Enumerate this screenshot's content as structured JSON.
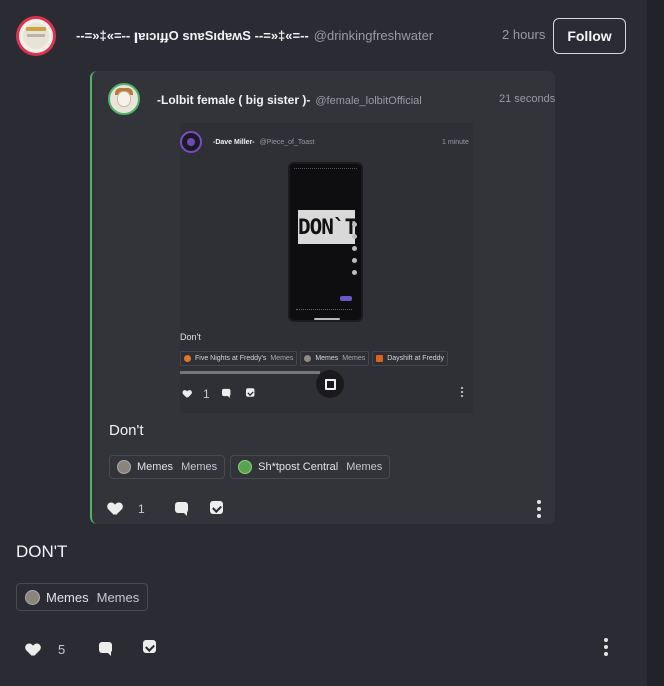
{
  "post": {
    "author_name": "--=»‡«=-- ꞁɐıɔıɟɟO snɐSıdɐʍS --=»‡«=--",
    "author_handle": "@drinkingfreshwater",
    "time": "2 hours",
    "follow_label": "Follow",
    "caption": "DON'T",
    "tags": [
      {
        "icon": "memes-community-icon",
        "community": "Memes",
        "channel": "Memes"
      }
    ],
    "likes": "5"
  },
  "quote": {
    "author_name": "-Lolbit female ( big sister )-",
    "author_handle": "@female_lolbitOfficial",
    "time": "21 seconds",
    "caption": "Don't",
    "tags": [
      {
        "icon": "memes-community-icon",
        "community": "Memes",
        "channel": "Memes"
      },
      {
        "icon": "shitpost-community-icon",
        "community": "Sh*tpost Central",
        "channel": "Memes"
      }
    ],
    "likes": "1"
  },
  "inner": {
    "author_name": "-Dave Miller-",
    "author_handle": "@Piece_of_Toast",
    "time": "1 minute",
    "video_text": "DON`T",
    "caption": "Don't",
    "tags": [
      {
        "icon": "fnaf-icon",
        "community": "Five Nights at Freddy's",
        "channel": "Memes"
      },
      {
        "icon": "memes-community-icon",
        "community": "Memes",
        "channel": "Memes"
      },
      {
        "icon": "dayshift-icon",
        "community": "Dayshift at Freddy"
      }
    ],
    "likes": "1"
  },
  "colors": {
    "background": "#2b2c33",
    "quote_border": "#4fb36a",
    "main_avatar_ring": "#d9334f",
    "inner_avatar_ring": "#7a4dc1"
  }
}
